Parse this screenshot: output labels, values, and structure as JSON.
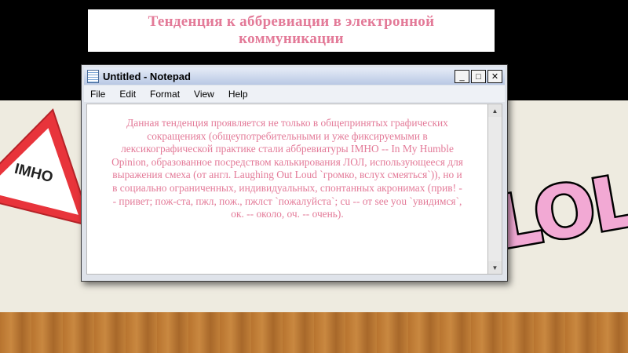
{
  "slide": {
    "title": "Тенденция к аббревиации в электронной коммуникации",
    "left_sign_text": "IMHO",
    "right_art_text": "LOL"
  },
  "notepad": {
    "window_title": "Untitled - Notepad",
    "buttons": {
      "minimize": "_",
      "maximize": "□",
      "close": "✕"
    },
    "menu": [
      "File",
      "Edit",
      "Format",
      "View",
      "Help"
    ],
    "content": "Данная тенденция проявляется не только в общепринятых графических сокращениях (общеупотребительными и уже фиксируемыми в лексикографической практике стали аббревиатуры IMHO -- In My Humble Opinion, образованное посредством калькирования ЛОЛ, использующееся для выражения смеха (от англ. Laughing Out Loud `громко, вслух смеяться`)), но и в социально ограниченных, индивидуальных, спонтанных акронимах (прив! -- привет; пож-ста, пжл, пож., пжлст `пожалуйста`; cu -- от see you `увидимся`, ок. -- около, оч. -- очень).",
    "icons": {
      "app": "notepad-icon",
      "scroll_up": "arrow-up-icon",
      "scroll_down": "arrow-down-icon"
    }
  },
  "colors": {
    "accent_pink": "#e37a98",
    "sign_red": "#e8343b",
    "lol_pink": "#f2a9d4"
  }
}
